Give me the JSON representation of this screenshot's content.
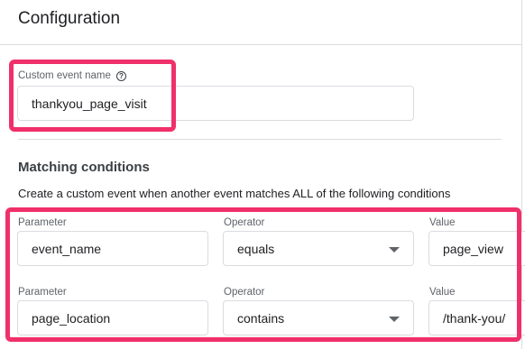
{
  "header": {
    "title": "Configuration"
  },
  "custom_event": {
    "label": "Custom event name",
    "help_icon": "help-circle-icon",
    "value": "thankyou_page_visit"
  },
  "matching": {
    "title": "Matching conditions",
    "description": "Create a custom event when another event matches ALL of the following conditions"
  },
  "conditions": [
    {
      "parameter_label": "Parameter",
      "parameter": "event_name",
      "operator_label": "Operator",
      "operator": "equals",
      "value_label": "Value",
      "value": "page_view"
    },
    {
      "parameter_label": "Parameter",
      "parameter": "page_location",
      "operator_label": "Operator",
      "operator": "contains",
      "value_label": "Value",
      "value": "/thank-you/"
    }
  ],
  "colors": {
    "highlight": "#f0306a",
    "border": "#dadce0"
  }
}
